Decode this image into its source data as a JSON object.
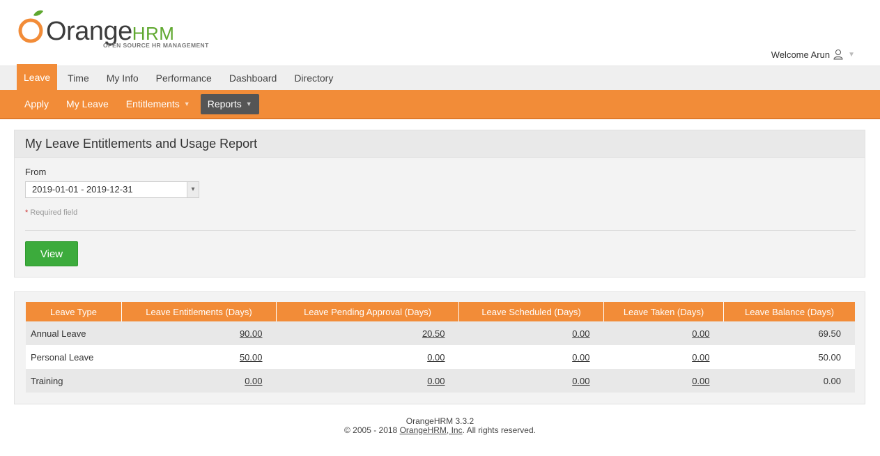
{
  "brand": {
    "logo_orange": "Orange",
    "logo_hrm": "HRM",
    "tagline": "OPEN SOURCE HR MANAGEMENT"
  },
  "user": {
    "welcome": "Welcome Arun"
  },
  "main_menu": [
    "Leave",
    "Time",
    "My Info",
    "Performance",
    "Dashboard",
    "Directory"
  ],
  "sub_menu": [
    "Apply",
    "My Leave",
    "Entitlements",
    "Reports"
  ],
  "report": {
    "title": "My Leave Entitlements and Usage Report",
    "from_label": "From",
    "from_value": "2019-01-01 - 2019-12-31",
    "required_star": "*",
    "required_text": " Required field",
    "view_button": "View"
  },
  "table": {
    "headers": [
      "Leave Type",
      "Leave Entitlements (Days)",
      "Leave Pending Approval (Days)",
      "Leave Scheduled (Days)",
      "Leave Taken (Days)",
      "Leave Balance (Days)"
    ],
    "rows": [
      [
        "Annual Leave",
        "90.00",
        "20.50",
        "0.00",
        "0.00",
        "69.50"
      ],
      [
        "Personal Leave",
        "50.00",
        "0.00",
        "0.00",
        "0.00",
        "50.00"
      ],
      [
        "Training",
        "0.00",
        "0.00",
        "0.00",
        "0.00",
        "0.00"
      ]
    ]
  },
  "footer": {
    "version": "OrangeHRM 3.3.2",
    "copyright_prefix": "© 2005 - 2018 ",
    "company_link": "OrangeHRM, Inc",
    "copyright_suffix": ". All rights reserved."
  },
  "colors": {
    "accent": "#f28c38",
    "button_green": "#3cab3c",
    "submenu_current": "#555555"
  }
}
